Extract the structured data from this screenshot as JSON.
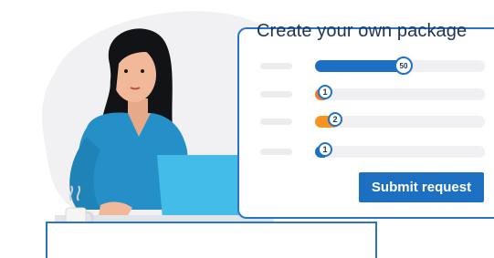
{
  "package_card": {
    "title": "Create your own package",
    "rows": [
      {
        "value": "50",
        "level": 0.52,
        "fill_color": "#1d6fc1"
      },
      {
        "value": "1",
        "level": 0.06,
        "fill_color": "#f27a2a"
      },
      {
        "value": "2",
        "level": 0.12,
        "fill_color": "#f7931e"
      },
      {
        "value": "1",
        "level": 0.06,
        "fill_color": "#1d6fc1"
      }
    ],
    "submit_label": "Submit request"
  },
  "colors": {
    "accent": "#1d6fc1",
    "card_border": "#2b73c7",
    "title_text": "#1e3553",
    "track": "#f0f0f2",
    "orange": "#f27a2a",
    "blob": "#f1f1f3"
  }
}
